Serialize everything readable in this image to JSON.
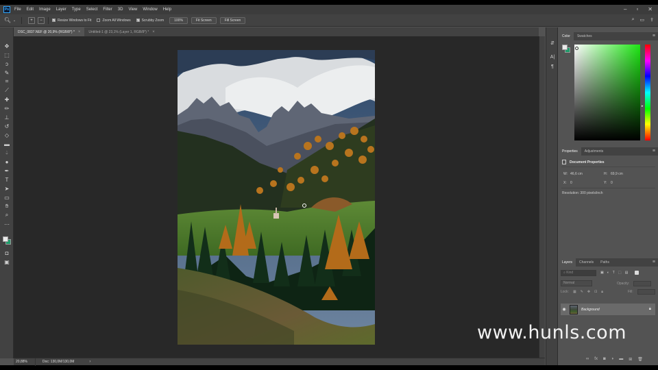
{
  "menubar": {
    "logo": "Ps",
    "items": [
      "File",
      "Edit",
      "Image",
      "Layer",
      "Type",
      "Select",
      "Filter",
      "3D",
      "View",
      "Window",
      "Help"
    ]
  },
  "options": {
    "resize_windows": "Resize Windows to Fit",
    "zoom_all": "Zoom All Windows",
    "scrubby_zoom": "Scrubby Zoom",
    "zoom_100": "100%",
    "fit_screen": "Fit Screen",
    "fill_screen": "Fill Screen"
  },
  "tabs": [
    {
      "label": "DSC_0837.NEF @ 20,9% (RGB/8*) *",
      "active": true
    },
    {
      "label": "Untitled-1 @ 23,1% (Layer 1, RGB/8*) *",
      "active": false
    }
  ],
  "status": {
    "zoom": "20,88%",
    "doc": "Doc: 130,0M/130,0M",
    "arrow": "›"
  },
  "color_panel": {
    "tabs": [
      "Color",
      "Swatches"
    ],
    "foreground": "#eaeaea",
    "background": "#1f9b6a",
    "hue_color": "#1ee614"
  },
  "properties_panel": {
    "tabs": [
      "Properties",
      "Adjustments"
    ],
    "title": "Document Properties",
    "w_label": "W:",
    "w_value": "46,6 cm",
    "h_label": "H:",
    "h_value": "69,9 cm",
    "x_label": "X:",
    "x_value": "0",
    "y_label": "Y:",
    "y_value": "0",
    "resolution": "Resolution: 300 pixels/inch"
  },
  "layers_panel": {
    "tabs": [
      "Layers",
      "Channels",
      "Paths"
    ],
    "filter_placeholder": "Kind",
    "blend_mode": "Normal",
    "opacity_label": "Opacity:",
    "fill_label": "Fill:",
    "lock_label": "Lock:",
    "layer_name": "Background"
  },
  "watermark": "www.hunls.com"
}
